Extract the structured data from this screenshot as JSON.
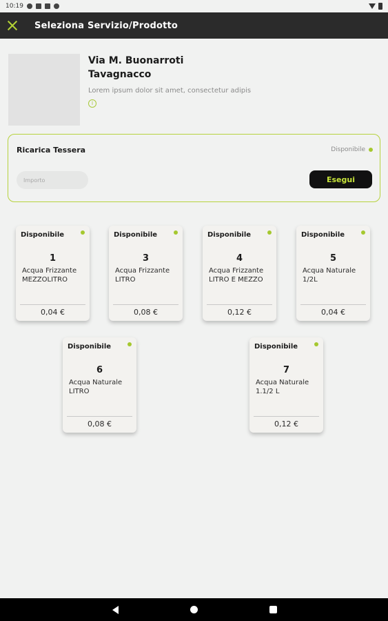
{
  "status_bar": {
    "time": "10:19"
  },
  "app_bar": {
    "title": "Seleziona Servizio/Prodotto"
  },
  "location": {
    "street": "Via M. Buonarroti",
    "city": "Tavagnacco",
    "description": "Lorem ipsum dolor sit amet, consectetur adipis",
    "info_glyph": "i"
  },
  "ricarica": {
    "title": "Ricarica Tessera",
    "status": "Disponibile",
    "amount_placeholder": "Importo",
    "submit_label": "Esegui"
  },
  "products": [
    {
      "status": "Disponibile",
      "number": "1",
      "name": "Acqua Frizzante MEZZOLITRO",
      "price": "0,04 €"
    },
    {
      "status": "Disponibile",
      "number": "3",
      "name": "Acqua Frizzante LITRO",
      "price": "0,08 €"
    },
    {
      "status": "Disponibile",
      "number": "4",
      "name": "Acqua Frizzante LITRO E MEZZO",
      "price": "0,12 €"
    },
    {
      "status": "Disponibile",
      "number": "5",
      "name": "Acqua Naturale 1/2L",
      "price": "0,04 €"
    },
    {
      "status": "Disponibile",
      "number": "6",
      "name": "Acqua Naturale LITRO",
      "price": "0,08 €"
    },
    {
      "status": "Disponibile",
      "number": "7",
      "name": "Acqua Naturale 1.1/2 L",
      "price": "0,12 €"
    }
  ],
  "colors": {
    "accent": "#a5c82f",
    "appbar": "#2b2b2b",
    "button": "#111111"
  }
}
